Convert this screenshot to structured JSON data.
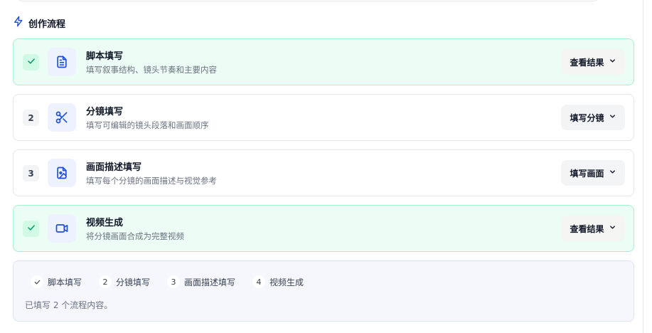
{
  "section": {
    "title": "创作流程",
    "icon": "lightning-icon"
  },
  "colors": {
    "accent": "#1d4ed8",
    "done_bg": "#ecfdf5",
    "done_border": "#a7f3d0",
    "done_check": "#059669"
  },
  "steps": [
    {
      "number": "1",
      "status": "done",
      "icon": "document-icon",
      "title": "脚本填写",
      "description": "填写叙事结构、镜头节奏和主要内容",
      "action": "查看结果"
    },
    {
      "number": "2",
      "status": "pending",
      "icon": "scissors-icon",
      "title": "分镜填写",
      "description": "填写可编辑的镜头段落和画面顺序",
      "action": "填写分镜"
    },
    {
      "number": "3",
      "status": "pending",
      "icon": "image-file-icon",
      "title": "画面描述填写",
      "description": "填写每个分镜的画面描述与视觉参考",
      "action": "填写画面"
    },
    {
      "number": "4",
      "status": "done",
      "icon": "video-icon",
      "title": "视频生成",
      "description": "将分镜画面合成为完整视频",
      "action": "查看结果"
    }
  ],
  "summary": {
    "chips": [
      {
        "mark": "check",
        "label": "脚本填写"
      },
      {
        "mark": "2",
        "label": "分镜填写"
      },
      {
        "mark": "3",
        "label": "画面描述填写"
      },
      {
        "mark": "4",
        "label": "视频生成"
      }
    ],
    "text": "已填写 2 个流程内容。"
  }
}
